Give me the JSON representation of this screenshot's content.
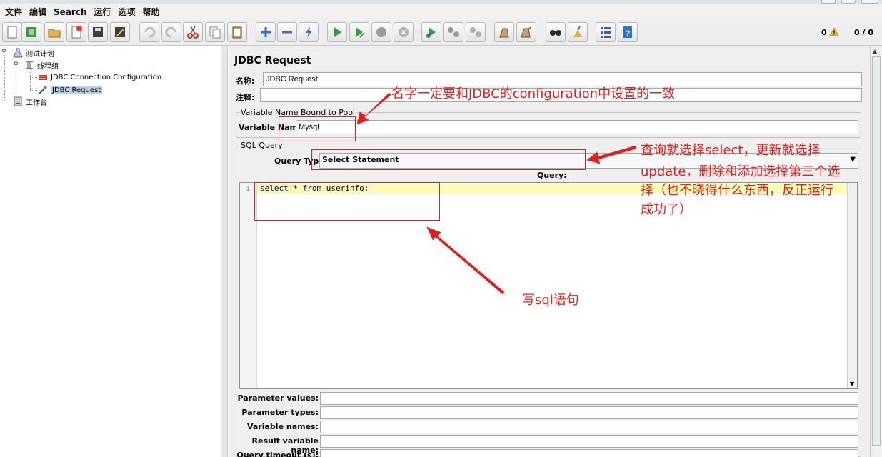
{
  "menu": [
    "文件",
    "编辑",
    "Search",
    "运行",
    "选项",
    "帮助"
  ],
  "toolbar": {
    "buttons": [
      {
        "name": "new-icon",
        "color": "#fafafa"
      },
      {
        "name": "templates-icon",
        "color": "#3b9a3c"
      },
      {
        "name": "open-icon",
        "color": "#d9a637"
      },
      {
        "name": "close-icon",
        "color": "#e23b2b"
      },
      {
        "name": "save-icon",
        "color": "#3c3c3c"
      },
      {
        "name": "save-as-icon",
        "color": "#c9a22e"
      },
      {
        "name": "undo-icon",
        "color": "#bcbcbc"
      },
      {
        "name": "redo-icon",
        "color": "#bcbcbc"
      },
      {
        "name": "cut-icon",
        "color": "#c0392b"
      },
      {
        "name": "copy-icon",
        "color": "#8a8a8a"
      },
      {
        "name": "paste-icon",
        "color": "#8a6d3b"
      },
      {
        "name": "expand-icon",
        "color": "#2f74c4"
      },
      {
        "name": "collapse-icon",
        "color": "#2f74c4"
      },
      {
        "name": "toggle-icon",
        "color": "#2f74c4"
      },
      {
        "name": "start-icon",
        "color": "#2aa33a"
      },
      {
        "name": "start-no-pause-icon",
        "color": "#2aa33a"
      },
      {
        "name": "stop-icon",
        "color": "#9a9a9a"
      },
      {
        "name": "shutdown-icon",
        "color": "#9a9a9a"
      },
      {
        "name": "remote-start-icon",
        "color": "#2aa33a"
      },
      {
        "name": "remote-stop-icon",
        "color": "#9a9a9a"
      },
      {
        "name": "remote-shutdown-icon",
        "color": "#9a9a9a"
      },
      {
        "name": "clear-icon",
        "color": "#b5894a"
      },
      {
        "name": "clear-all-icon",
        "color": "#b5894a"
      },
      {
        "name": "search-icon",
        "color": "#2b2b2b"
      },
      {
        "name": "reset-search-icon",
        "color": "#e2b23b"
      },
      {
        "name": "function-helper-icon",
        "color": "#3a5fa0"
      },
      {
        "name": "help-icon",
        "color": "#2f74c4"
      }
    ],
    "error_count": "0",
    "thread_count": "0 / 0"
  },
  "tree": {
    "test_plan": "测试计划",
    "thread_group": "线程组",
    "jdbc_config": "JDBC Connection Configuration",
    "jdbc_request": "JDBC Request",
    "workbench": "工作台"
  },
  "form": {
    "title": "JDBC Request",
    "name_label": "名称:",
    "name_value": "JDBC Request",
    "comments_label": "注释:",
    "comments_value": "",
    "pool_group_title": "Variable Name Bound to Pool",
    "variable_name_label": "Variable Name:",
    "variable_name_value": "Mysql",
    "sql_group_title": "SQL Query",
    "query_type_label": "Query Type:",
    "query_type_value": "Select Statement",
    "query_label": "Query:",
    "line_number": "1",
    "query_keyword_1": "select",
    "query_middle": " * ",
    "query_keyword_2": "from",
    "query_tail": " userinfo;",
    "params": [
      {
        "label": "Parameter values:"
      },
      {
        "label": "Parameter types:"
      },
      {
        "label": "Variable names:"
      },
      {
        "label": "Result variable name:"
      },
      {
        "label": "Query timeout (s):"
      }
    ]
  },
  "annotations": {
    "name_note": "名字一定要和JDBC的configuration中设置的一致",
    "type_note_1": "查询就选择select，更新就选择",
    "type_note_2": "update，删除和添加选择第三个选",
    "type_note_3": "择（也不晓得什么东西，反正运行",
    "type_note_4": "成功了）",
    "sql_note": "写sql语句",
    "color": "#e0201c"
  }
}
